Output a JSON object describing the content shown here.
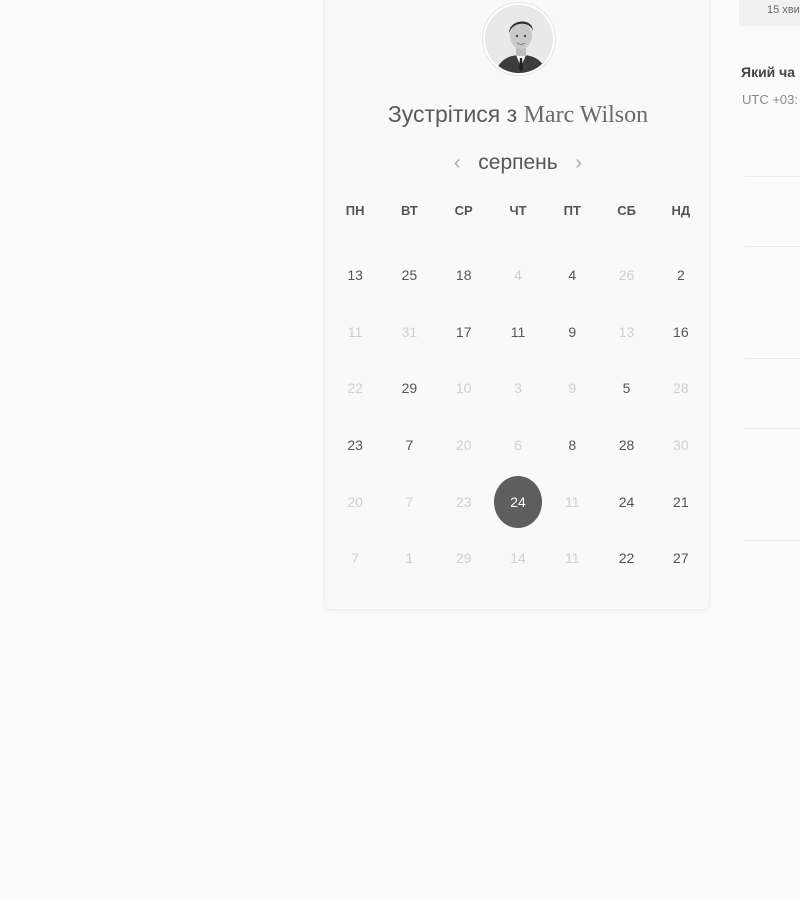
{
  "meeting": {
    "title_prefix": "Зустрітися з",
    "host_name": "Marc Wilson"
  },
  "calendar": {
    "month": "серпень",
    "prev_icon": "‹",
    "next_icon": "›",
    "weekdays": [
      "ПН",
      "ВТ",
      "СР",
      "ЧТ",
      "ПТ",
      "СБ",
      "НД"
    ],
    "weeks": [
      [
        {
          "d": "13",
          "m": false
        },
        {
          "d": "25",
          "m": false
        },
        {
          "d": "18",
          "m": false
        },
        {
          "d": "4",
          "m": true
        },
        {
          "d": "4",
          "m": false
        },
        {
          "d": "26",
          "m": true
        },
        {
          "d": "2",
          "m": false
        }
      ],
      [
        {
          "d": "11",
          "m": true
        },
        {
          "d": "31",
          "m": true
        },
        {
          "d": "17",
          "m": false
        },
        {
          "d": "11",
          "m": false
        },
        {
          "d": "9",
          "m": false
        },
        {
          "d": "13",
          "m": true
        },
        {
          "d": "16",
          "m": false
        }
      ],
      [
        {
          "d": "22",
          "m": true
        },
        {
          "d": "29",
          "m": false
        },
        {
          "d": "10",
          "m": true
        },
        {
          "d": "3",
          "m": true
        },
        {
          "d": "9",
          "m": true
        },
        {
          "d": "5",
          "m": false
        },
        {
          "d": "28",
          "m": true
        }
      ],
      [
        {
          "d": "23",
          "m": false
        },
        {
          "d": "7",
          "m": false
        },
        {
          "d": "20",
          "m": true
        },
        {
          "d": "6",
          "m": true
        },
        {
          "d": "8",
          "m": false
        },
        {
          "d": "28",
          "m": false
        },
        {
          "d": "30",
          "m": true
        }
      ],
      [
        {
          "d": "20",
          "m": true
        },
        {
          "d": "7",
          "m": true
        },
        {
          "d": "23",
          "m": true
        },
        {
          "d": "24",
          "m": false,
          "selected": true
        },
        {
          "d": "11",
          "m": true
        },
        {
          "d": "24",
          "m": false
        },
        {
          "d": "21",
          "m": false
        }
      ],
      [
        {
          "d": "7",
          "m": true
        },
        {
          "d": "1",
          "m": true
        },
        {
          "d": "29",
          "m": true
        },
        {
          "d": "14",
          "m": true
        },
        {
          "d": "11",
          "m": true
        },
        {
          "d": "22",
          "m": false
        },
        {
          "d": "27",
          "m": false
        }
      ]
    ]
  },
  "side_panel": {
    "duration": "15 хви",
    "question": "Який ча",
    "timezone": "UTC +03:"
  },
  "icons": {
    "avatar": "person-photo-icon"
  }
}
